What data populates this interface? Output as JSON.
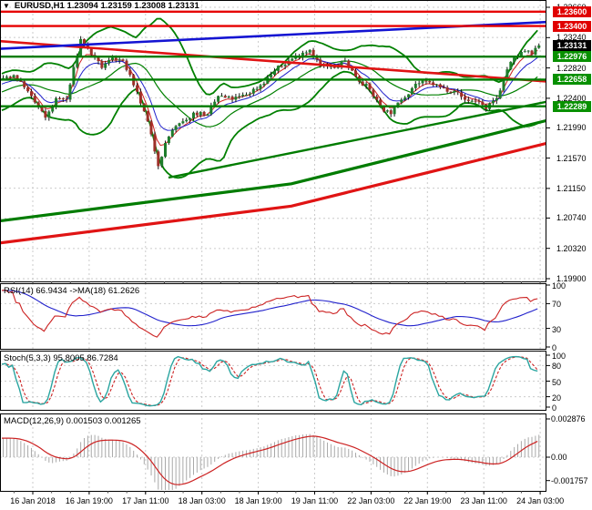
{
  "title": {
    "marker": "▼",
    "text": "EURUSD,H1  1.23094 1.23159 1.23008 1.23131"
  },
  "colors": {
    "background": "#ffffff",
    "grid": "#cbcbcb",
    "border": "#000000",
    "bull": "#1e7d2c",
    "bear": "#9e2f28",
    "wick": "#141414",
    "bollinger": "#008000",
    "ema_fast": "#d02020",
    "ema_mid": "#2020cc",
    "sr_green": "#007c00",
    "sr_red": "#e60000",
    "trend_blue": "#1414d2",
    "trend_red": "#e01414",
    "rsi_line": "#cc2222",
    "rsi_ma": "#2222cc",
    "stoch_k": "#2aa5a0",
    "stoch_d": "#cc2222",
    "macd_hist": "#a9a9a9",
    "macd_signal": "#cc2222",
    "badge_resistance": "#e00000",
    "badge_support": "#089000",
    "badge_current": "#000000"
  },
  "main_chart": {
    "price_axis": [
      "1.23660",
      "1.23240",
      "1.22820",
      "1.22400",
      "1.21990",
      "1.21570",
      "1.21150",
      "1.20740",
      "1.20320",
      "1.19900"
    ],
    "badges": [
      {
        "label": "1.23600",
        "type": "resistance"
      },
      {
        "label": "1.23400",
        "type": "resistance"
      },
      {
        "label": "1.23131",
        "type": "current"
      },
      {
        "label": "1.22976",
        "type": "support"
      },
      {
        "label": "1.22658",
        "type": "support"
      },
      {
        "label": "1.22289",
        "type": "support"
      }
    ]
  },
  "panels": {
    "rsi": {
      "label": "RSI(14) 66.9434  ->MA(18) 61.2626",
      "axis": [
        "100",
        "70",
        "30",
        "0"
      ],
      "levels": [
        70,
        30
      ]
    },
    "stoch": {
      "label": "Stoch(5,3,3) 95.8005 86.7284",
      "axis": [
        "100",
        "80",
        "50",
        "20",
        "0"
      ],
      "levels": [
        80,
        50,
        20
      ]
    },
    "macd": {
      "label": "MACD(12,26,9) 0.001503 0.001265",
      "axis": [
        {
          "label": "0.002876",
          "value": 0.002876
        },
        {
          "label": "0.00",
          "value": 0
        },
        {
          "label": "-0.001757",
          "value": -0.001757
        }
      ]
    }
  },
  "x_axis": [
    "16 Jan 2018",
    "16 Jan 19:00",
    "17 Jan 11:00",
    "18 Jan 03:00",
    "18 Jan 19:00",
    "19 Jan 11:00",
    "22 Jan 03:00",
    "22 Jan 19:00",
    "23 Jan 11:00",
    "24 Jan 03:00"
  ],
  "chart_data": {
    "type": "candlestick",
    "symbol": "EURUSD",
    "timeframe": "H1",
    "ohlc_current": {
      "open": 1.23094,
      "high": 1.23159,
      "low": 1.23008,
      "close": 1.23131
    },
    "candle_count": 153,
    "price_path_anchors": [
      [
        0,
        1.2268
      ],
      [
        3,
        1.2272
      ],
      [
        6,
        1.2255
      ],
      [
        12,
        1.2213
      ],
      [
        15,
        1.224
      ],
      [
        18,
        1.2238
      ],
      [
        22,
        1.2322
      ],
      [
        25,
        1.23
      ],
      [
        28,
        1.2282
      ],
      [
        31,
        1.2296
      ],
      [
        34,
        1.2292
      ],
      [
        37,
        1.2258
      ],
      [
        40,
        1.2222
      ],
      [
        42,
        1.219
      ],
      [
        44,
        1.2146
      ],
      [
        46,
        1.2178
      ],
      [
        48,
        1.2196
      ],
      [
        52,
        1.221
      ],
      [
        54,
        1.222
      ],
      [
        58,
        1.2218
      ],
      [
        61,
        1.2243
      ],
      [
        65,
        1.2238
      ],
      [
        69,
        1.2245
      ],
      [
        73,
        1.2258
      ],
      [
        77,
        1.2278
      ],
      [
        81,
        1.2292
      ],
      [
        85,
        1.2303
      ],
      [
        87,
        1.2307
      ],
      [
        90,
        1.2285
      ],
      [
        94,
        1.2282
      ],
      [
        97,
        1.2292
      ],
      [
        100,
        1.227
      ],
      [
        104,
        1.2252
      ],
      [
        107,
        1.2228
      ],
      [
        110,
        1.2218
      ],
      [
        113,
        1.2238
      ],
      [
        117,
        1.226
      ],
      [
        121,
        1.2262
      ],
      [
        124,
        1.2255
      ],
      [
        128,
        1.225
      ],
      [
        131,
        1.2238
      ],
      [
        135,
        1.2235
      ],
      [
        137,
        1.2225
      ],
      [
        140,
        1.224
      ],
      [
        143,
        1.228
      ],
      [
        145,
        1.2296
      ],
      [
        148,
        1.2305
      ],
      [
        150,
        1.23
      ],
      [
        152,
        1.23131
      ]
    ],
    "levels": [
      {
        "price": 1.236,
        "kind": "resistance"
      },
      {
        "price": 1.234,
        "kind": "resistance"
      },
      {
        "price": 1.22976,
        "kind": "support"
      },
      {
        "price": 1.22658,
        "kind": "support"
      },
      {
        "price": 1.22289,
        "kind": "support"
      }
    ],
    "trendlines": [
      {
        "name": "ascending-blue-trendline",
        "color_key": "trend_blue",
        "width": 2.6,
        "points": [
          [
            0,
            1.23085
          ],
          [
            600,
            1.23455
          ]
        ]
      },
      {
        "name": "descending-red-trendline",
        "color_key": "trend_red",
        "width": 2.6,
        "points": [
          [
            0,
            1.2319
          ],
          [
            600,
            1.22633
          ]
        ]
      },
      {
        "name": "ascending-green-support",
        "color_key": "sr_green",
        "width": 2.4,
        "points": [
          [
            185,
            1.213
          ],
          [
            600,
            1.2235
          ]
        ]
      },
      {
        "name": "slow-ma-green",
        "color_key": "sr_green",
        "width": 3.2,
        "points": [
          [
            0,
            1.207
          ],
          [
            320,
            1.21215
          ],
          [
            600,
            1.2209
          ]
        ]
      },
      {
        "name": "slow-ma-red",
        "color_key": "trend_red",
        "width": 3.2,
        "points": [
          [
            0,
            1.20395
          ],
          [
            320,
            1.20905
          ],
          [
            600,
            1.21775
          ]
        ]
      }
    ],
    "indicators": {
      "bollinger": {
        "period": 20,
        "deviation": 2
      },
      "rsi": {
        "period": 14,
        "value": 66.9434,
        "ma_period": 18,
        "ma_value": 61.2626
      },
      "stochastic": {
        "k": 5,
        "d": 3,
        "slowing": 3,
        "main": 95.8005,
        "signal": 86.7284
      },
      "macd": {
        "fast": 12,
        "slow": 26,
        "signal_period": 9,
        "main": 0.001503,
        "signal": 0.001265
      }
    },
    "y_axis_range": [
      1.199,
      1.2366
    ],
    "grid": true
  }
}
